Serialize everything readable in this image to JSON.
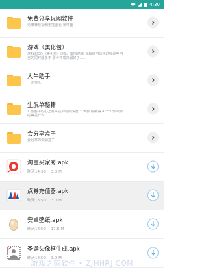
{
  "status_bar": {
    "time": "4:30"
  },
  "folders": [
    {
      "title": "免费分享玩网软件",
      "subtitle": "无推荐短视和无插图看 我可面"
    },
    {
      "title": "游戏（美化包）",
      "subtitle": "游戏和QQ（美化包）你单、如有前面 我相信可以越过我那些自己的同时都多于 那个下载来最好了……"
    },
    {
      "title": "大牛助手",
      "subtitle": "一切快乐"
    },
    {
      "title": "生脱单秘籍",
      "subtitle": "1.想要中的心上有实在的时间深度 3.大脚 脱就得 4.一个你的那的美是什么"
    },
    {
      "title": "会分享盒子",
      "subtitle": "会分享的资源盒子"
    }
  ],
  "files": [
    {
      "name": "淘宝买家秀.apk",
      "date": "昨天14:36",
      "size": "3.0 M",
      "icon": "taobao-icon",
      "icon_color": "#e8392f"
    },
    {
      "name": "点券充值器.apk",
      "date": "昨天18:50",
      "size": "3.0 M",
      "icon": "voucher-icon",
      "icon_color": "#1e5fae"
    },
    {
      "name": "安卓壁纸.apk",
      "date": "昨天18:50",
      "size": "17.5 M",
      "icon": "egg-icon",
      "icon_color": "#e0c69a"
    },
    {
      "name": "圣诞头像框生成.apk",
      "date": "昨天18:50",
      "size": "3.0 M",
      "icon": "avatar-frame-icon",
      "icon_color": "#555555"
    }
  ],
  "watermark": "游戏之家软件 • ZJHHRJ.COM",
  "colors": {
    "status_bar": "#26a69a",
    "folder": "#fbc64b",
    "download_ring": "#9cc9ea",
    "download_arrow": "#5aa9de"
  }
}
